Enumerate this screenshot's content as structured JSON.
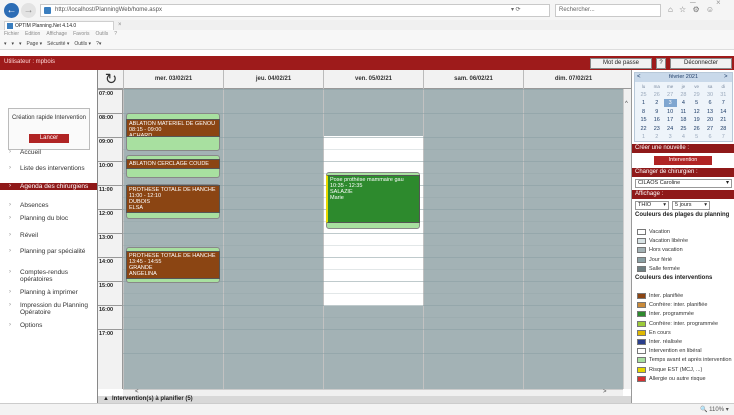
{
  "browser": {
    "url": "http://localhost/PlanningWeb/home.aspx",
    "url_controls": "▾ ⟳",
    "search_placeholder": "Rechercher...",
    "tab_title": "OPTIM Planning.Net 4.14.0",
    "tab_close": "×",
    "nav_back": "←",
    "nav_forward": "→",
    "toolbar_icons": "⌂ ☆ ⚙ ☺",
    "window_min": "─",
    "window_close": "×",
    "menu_items": [
      "Fichier",
      "Edition",
      "Affichage",
      "Favoris",
      "Outils",
      "?"
    ],
    "command_items": [
      "▾",
      "▾",
      "▾",
      "Page ▾",
      "Sécurité ▾",
      "Outils ▾",
      "?▾"
    ],
    "zoom": "🔍 110%  ▾"
  },
  "app_bar": {
    "user_label": "Utilisateur : mpbois",
    "btn_password": "Mot de passe",
    "btn_help": "?",
    "btn_logout": "Déconnecter"
  },
  "left": {
    "quick_title": "Création rapide Intervention",
    "quick_btn": "Lancer",
    "nav_items": [
      "Accueil",
      "Liste des interventions",
      "Agenda des chirurgiens",
      "Absences",
      "Planning du bloc",
      "Réveil",
      "Planning par spécialité",
      "Comptes-rendus opératoires",
      "Planning à imprimer",
      "Impression du Planning Opératoire",
      "Options"
    ]
  },
  "calendar": {
    "refresh_icon": "↻",
    "days": [
      "mer. 03/02/21",
      "jeu. 04/02/21",
      "ven. 05/02/21",
      "sam. 06/02/21",
      "dim. 07/02/21"
    ],
    "hours": [
      "07:00",
      "08:00",
      "09:00",
      "10:00",
      "11:00",
      "12:00",
      "13:00",
      "14:00",
      "15:00",
      "16:00",
      "17:00"
    ],
    "events": [
      {
        "title": "ABLATION MATERIEL DE GENOU",
        "time": "08:15 - 09:00",
        "surgeon": "ACHARD",
        "patient": ""
      },
      {
        "title": "ABLATION CERCLAGE COUDE",
        "time": "",
        "surgeon": "",
        "patient": ""
      },
      {
        "title": "PROTHESE TOTALE DE HANCHE",
        "time": "11:00 - 12:10",
        "surgeon": "DUBOIS",
        "patient": "ELSA"
      },
      {
        "title": "PROTHESE TOTALE DE HANCHE",
        "time": "13:45 - 14:55",
        "surgeon": "GRANDE",
        "patient": "ANGELINA"
      },
      {
        "title": "Pose prothèse mammaire gau",
        "time": "10:35 - 12:35",
        "surgeon": "SALAZIE",
        "patient": "Marie"
      }
    ],
    "scroll_up": "^",
    "scroll_left": "<",
    "scroll_right": ">",
    "bottom_arrow": "▲",
    "bottom_label": "Intervention(s) à planifier (5)"
  },
  "right": {
    "mini_cal_title": "février 2021",
    "mini_cal_prev": "<",
    "mini_cal_next": ">",
    "weekdays": [
      "lu",
      "ma",
      "me",
      "je",
      "ve",
      "sa",
      "di"
    ],
    "weeks": [
      [
        "25",
        "26",
        "27",
        "28",
        "29",
        "30",
        "31"
      ],
      [
        "1",
        "2",
        "3",
        "4",
        "5",
        "6",
        "7"
      ],
      [
        "8",
        "9",
        "10",
        "11",
        "12",
        "13",
        "14"
      ],
      [
        "15",
        "16",
        "17",
        "18",
        "19",
        "20",
        "21"
      ],
      [
        "22",
        "23",
        "24",
        "25",
        "26",
        "27",
        "28"
      ],
      [
        "1",
        "2",
        "3",
        "4",
        "5",
        "6",
        "7"
      ]
    ],
    "create_label": "Créer une nouvelle :",
    "create_btn": "Intervention",
    "change_label": "Changer de chirurgien :",
    "surgeon_value": "CILAOS Caroline",
    "display_label": "Affichage :",
    "view_a": "THIO",
    "view_b": "5 jours",
    "dropdown_caret": "▾",
    "legend_plages_title": "Couleurs des plages du planning",
    "legend_plages": [
      {
        "label": "Vacation",
        "color": "#ffffff"
      },
      {
        "label": "Vacation libérée",
        "color": "#d9e4e6"
      },
      {
        "label": "Hors vacation",
        "color": "#a3b2b5"
      },
      {
        "label": "Jour férié",
        "color": "#8aa0a4"
      },
      {
        "label": "Salle fermée",
        "color": "#6f7f82"
      }
    ],
    "legend_interv_title": "Couleurs des interventions",
    "legend_interv": [
      {
        "label": "Inter. planifiée",
        "color": "#8b4513"
      },
      {
        "label": "Confrère: inter. planifiée",
        "color": "#c98a3a"
      },
      {
        "label": "Inter. programmée",
        "color": "#2d8a2d"
      },
      {
        "label": "Confrère: inter. programmée",
        "color": "#9ccb3a"
      },
      {
        "label": "En cours",
        "color": "#e0b800"
      },
      {
        "label": "Inter. réalisée",
        "color": "#2a3e8c"
      },
      {
        "label": "Intervention en libéral",
        "color": "#ffffff"
      },
      {
        "label": "Temps avant et après intervention",
        "color": "#a8e0a0"
      },
      {
        "label": "Risque EST (MCJ, ...)",
        "color": "#e6d800"
      },
      {
        "label": "Allergie ou autre risque",
        "color": "#d63030"
      }
    ]
  }
}
